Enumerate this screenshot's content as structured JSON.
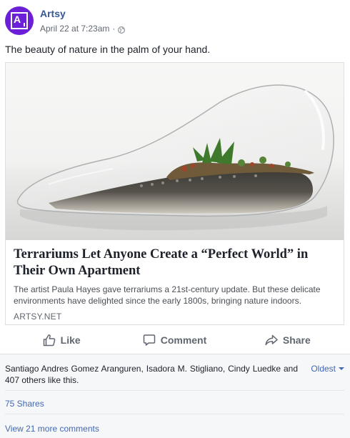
{
  "post": {
    "page_name": "Artsy",
    "timestamp": "April 22 at 7:23am",
    "separator": "·",
    "message": "The beauty of nature in the palm of your hand."
  },
  "link_card": {
    "title": "Terrariums Let Anyone Create a “Perfect World” in Their Own Apartment",
    "description": "The artist Paula Hayes gave terrariums a 21st-century update. But these delicate environments have delighted since the early 1800s, bringing nature indoors.",
    "domain": "ARTSY.NET"
  },
  "actions": {
    "like_label": "Like",
    "comment_label": "Comment",
    "share_label": "Share"
  },
  "footer": {
    "likes_text": "Santiago Andres Gomez Aranguren, Isadora M. Stigliano, Cindy Luedke and 407 others like this.",
    "sort_label": "Oldest",
    "shares_text": "75 Shares",
    "more_comments_text": "View 21 more comments"
  },
  "colors": {
    "avatar": "#6b1fd6",
    "link": "#365899",
    "accent": "#4267b2",
    "footer_bg": "#f6f7f9"
  },
  "icons": {
    "avatar": "artsy-logo-icon",
    "privacy": "globe-icon",
    "like": "thumbs-up-icon",
    "comment": "speech-bubble-icon",
    "share": "share-arrow-icon",
    "sort": "caret-down-icon"
  }
}
